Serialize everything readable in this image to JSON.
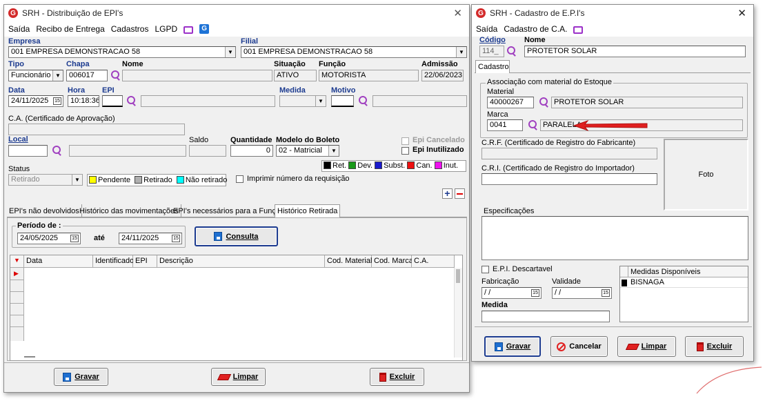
{
  "left_window": {
    "title": "SRH - Distribuição de EPI's",
    "menu": [
      "Saída",
      "Recibo de Entrega",
      "Cadastros",
      "LGPD"
    ],
    "empresa": {
      "label": "Empresa",
      "value": "001 EMPRESA DEMONSTRACAO 58"
    },
    "filial": {
      "label": "Filial",
      "value": "001 EMPRESA DEMONSTRACAO 58"
    },
    "tipo": {
      "label": "Tipo",
      "value": "Funcionário"
    },
    "chapa": {
      "label": "Chapa",
      "value": "006017"
    },
    "nome": {
      "label": "Nome",
      "value": ""
    },
    "situacao": {
      "label": "Situação",
      "value": "ATIVO"
    },
    "funcao": {
      "label": "Função",
      "value": "MOTORISTA"
    },
    "admissao": {
      "label": "Admissão",
      "value": "22/06/2023"
    },
    "data": {
      "label": "Data",
      "value": "24/11/2025"
    },
    "hora": {
      "label": "Hora",
      "value": "10:18:36"
    },
    "epi_label": "EPI",
    "medida_label": "Medida",
    "motivo_label": "Motivo",
    "ca_label": "C.A. (Certificado de Aprovação)",
    "local_label": "Local",
    "saldo_label": "Saldo",
    "quantidade": {
      "label": "Quantidade",
      "value": "0"
    },
    "modelo_boleto": {
      "label": "Modelo do Boleto",
      "value": "02 - Matricial"
    },
    "epi_cancelado": "Epi Cancelado",
    "epi_inutilizado": "Epi Inutilizado",
    "legend": [
      {
        "label": "Ret.",
        "color": "#000000"
      },
      {
        "label": "Dev.",
        "color": "#1a9a1a"
      },
      {
        "label": "Subst.",
        "color": "#1a1acc"
      },
      {
        "label": "Can.",
        "color": "#ee1111"
      },
      {
        "label": "Inut.",
        "color": "#ee11ee"
      }
    ],
    "status": {
      "label": "Status",
      "value": "Retirado",
      "options": [
        {
          "label": "Pendente",
          "color": "#ffff00"
        },
        {
          "label": "Retirado",
          "color": "#b0b0b0"
        },
        {
          "label": "Não retirado",
          "color": "#00ffff"
        }
      ]
    },
    "imprimir_label": "Imprimir número da requisição",
    "tabs": [
      "EPI's não devolvidos",
      "Histórico das movimentações",
      "EPI's necessários para a Função",
      "Histórico Retirada"
    ],
    "periodo": {
      "label": "Período de :",
      "from": "24/05/2025",
      "ate": "até",
      "to": "24/11/2025"
    },
    "consulta_label": "Consulta",
    "grid_columns": [
      "Data",
      "Identificador",
      "EPI",
      "Descrição",
      "Cod. Material",
      "Cod. Marca",
      "C.A."
    ],
    "buttons": {
      "gravar": "Gravar",
      "limpar": "Limpar",
      "excluir": "Excluir"
    }
  },
  "right_window": {
    "title": "SRH - Cadastro de E.P.I's",
    "menu": [
      "Saída",
      "Cadastro de C.A."
    ],
    "codigo": {
      "label": "Código",
      "value": "114_"
    },
    "nome": {
      "label": "Nome",
      "value": "PROTETOR SOLAR"
    },
    "tab": "Cadastro",
    "assoc_label": "Associação com material do Estoque",
    "material": {
      "label": "Material",
      "code": "40000267",
      "desc": "PROTETOR SOLAR"
    },
    "marca": {
      "label": "Marca",
      "code": "0041",
      "desc": "PARALELA"
    },
    "crf_label": "C.R.F. (Certificado de Registro do Fabricante)",
    "cri_label": "C.R.I. (Certificado de Registro do Importador)",
    "foto_label": "Foto",
    "especificacoes_label": "Especificações",
    "epi_descartavel": "E.P.I. Descartavel",
    "fabricacao": {
      "label": "Fabricação",
      "value": "/ /"
    },
    "validade": {
      "label": "Validade",
      "value": "/ /"
    },
    "medida_label": "Medida",
    "medidas": {
      "header": "Medidas Disponíveis",
      "items": [
        "BISNAGA"
      ]
    },
    "buttons": {
      "gravar": "Gravar",
      "cancelar": "Cancelar",
      "limpar": "Limpar",
      "excluir": "Excluir"
    }
  }
}
